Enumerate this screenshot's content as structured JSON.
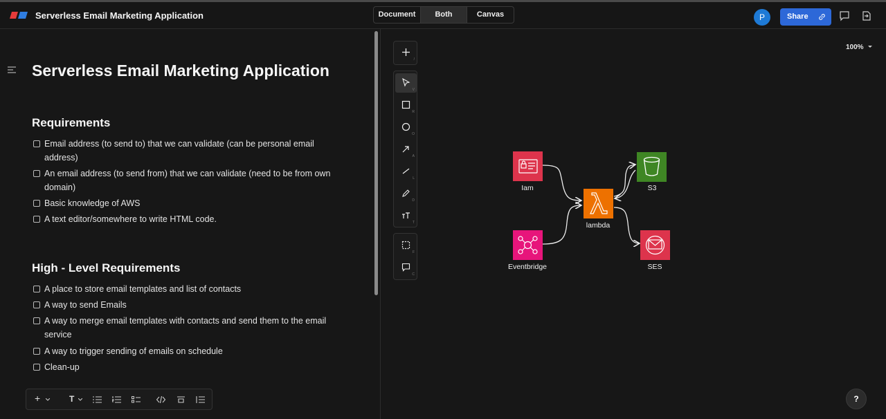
{
  "header": {
    "app_title": "Serverless Email Marketing Application",
    "view_tabs": [
      "Document",
      "Both",
      "Canvas"
    ],
    "active_tab": "Both",
    "avatar_initial": "P",
    "share_label": "Share"
  },
  "document": {
    "title": "Serverless Email Marketing Application",
    "sections": [
      {
        "heading": "Requirements",
        "items": [
          "Email address (to send to) that we can validate (can be personal email address)",
          "An email address (to send from) that we can validate (need to be from own domain)",
          "Basic knowledge of AWS",
          "A text editor/somewhere to write HTML code."
        ]
      },
      {
        "heading": "High - Level Requirements",
        "items": [
          "A place to store email templates and list of contacts",
          "A way to send Emails",
          "A way to merge email templates with contacts and send them to the email service",
          "A way to trigger sending of emails on schedule",
          "Clean-up"
        ]
      }
    ]
  },
  "format_toolbar": {
    "insert": "+",
    "text_style": "T"
  },
  "canvas_tools": {
    "keys": [
      "/",
      "V",
      "R",
      "O",
      "A",
      "L",
      "D",
      "T",
      "F",
      "C"
    ]
  },
  "canvas": {
    "zoom": "100%",
    "nodes": {
      "iam": "Iam",
      "s3": "S3",
      "lambda": "lambda",
      "eventbridge": "Eventbridge",
      "ses": "SES"
    },
    "colors": {
      "iam": "#dd344c",
      "s3": "#3f8624",
      "lambda": "#ed7100",
      "eventbridge": "#e7157b",
      "ses": "#dd344c"
    }
  },
  "help_label": "?"
}
